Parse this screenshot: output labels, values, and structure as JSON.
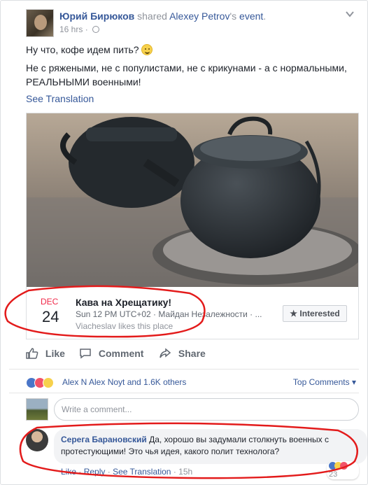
{
  "post": {
    "author": "Юрий Бирюков",
    "shared_text": "shared",
    "shared_owner": "Alexey Petrov",
    "possessive_suffix": "'s",
    "event_word": "event",
    "period": ".",
    "time": "16 hrs",
    "separator": "·",
    "text_line1": "Ну что, кофе идем пить?",
    "text_line2": "Не с ряжеными, не с популистами, не с крикунами - а с нормальными, РЕАЛЬНЫМИ военными!",
    "see_translation": "See Translation"
  },
  "event": {
    "month": "DEC",
    "day": "24",
    "title": "Кава на Хрещатику!",
    "time_place": "Sun 12 PM UTC+02 · Майдан Незалежности · ...",
    "likes_place": "Viacheslav likes this place",
    "interested_label": "Interested"
  },
  "actions": {
    "like": "Like",
    "comment": "Comment",
    "share": "Share"
  },
  "reactions": {
    "names": "Alex N Alex Noyt and 1.6K others",
    "top_comments": "Top Comments",
    "colors": {
      "like": "#4a76c8",
      "love": "#f25268",
      "wow": "#f7d14c"
    }
  },
  "write_comment": {
    "placeholder": "Write a comment...",
    "icons": [
      "emoji-icon",
      "camera-icon",
      "gif-icon",
      "sticker-icon"
    ]
  },
  "comment": {
    "author": "Серега Барановский",
    "text": "Да, хорошо вы задумали столкнуть военных с протестующими! Это чья идея, какого полит технолога?",
    "like": "Like",
    "reply": "Reply",
    "see_translation": "See Translation",
    "time": "15h",
    "dot": "·",
    "reaction_count": "23"
  },
  "colors": {
    "link": "#365899",
    "accent_red": "#f02849",
    "annotation_red": "#e31b1b"
  }
}
